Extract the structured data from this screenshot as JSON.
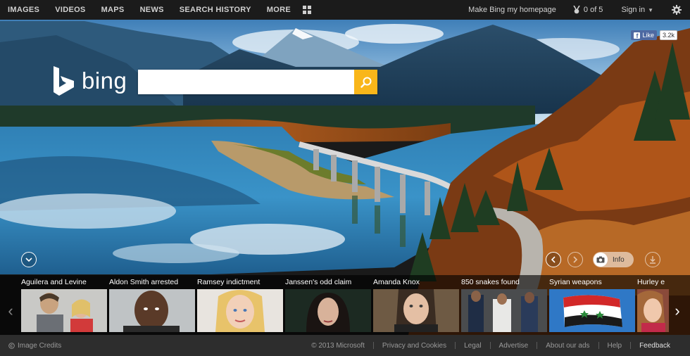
{
  "nav": {
    "items": [
      "IMAGES",
      "VIDEOS",
      "MAPS",
      "NEWS",
      "SEARCH HISTORY",
      "MORE"
    ],
    "apps_icon": "apps-grid-icon"
  },
  "header": {
    "homepage_link": "Make Bing my homepage",
    "rewards": "0 of 5",
    "rewards_icon": "medal-icon",
    "signin": "Sign in",
    "settings_icon": "gear-icon"
  },
  "facebook": {
    "like_label": "Like",
    "count": "3.2k"
  },
  "logo": {
    "text": "bing"
  },
  "search": {
    "value": "",
    "placeholder": "",
    "button_icon": "search-icon",
    "button_color": "#f9b61a"
  },
  "controls": {
    "info_label": "Info",
    "down_icon": "chevron-down-icon",
    "prev_icon": "chevron-left-icon",
    "next_icon": "chevron-right-icon",
    "download_icon": "download-icon"
  },
  "news": [
    {
      "title": "Aguilera and Levine"
    },
    {
      "title": "Aldon Smith arrested"
    },
    {
      "title": "Ramsey indictment"
    },
    {
      "title": "Janssen's odd claim"
    },
    {
      "title": "Amanda Knox"
    },
    {
      "title": "850 snakes found"
    },
    {
      "title": "Syrian weapons"
    },
    {
      "title": "Hurley e"
    }
  ],
  "footer": {
    "credits": "Image Credits",
    "links": [
      "© 2013 Microsoft",
      "Privacy and Cookies",
      "Legal",
      "Advertise",
      "About our ads",
      "Help",
      "Feedback"
    ]
  },
  "colors": {
    "accent": "#f9b61a",
    "topbar": "#1b1b1b",
    "footer": "#2d2d2d"
  }
}
